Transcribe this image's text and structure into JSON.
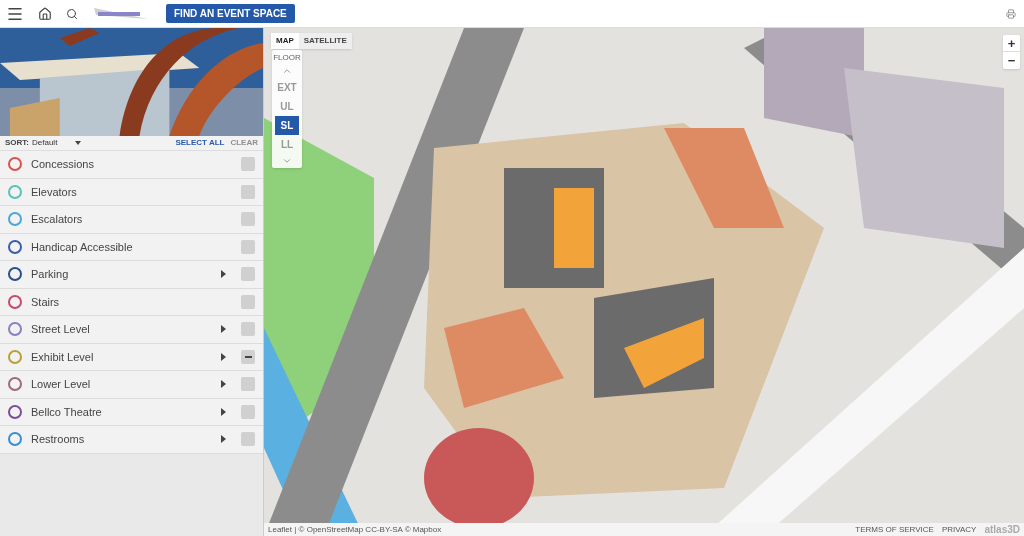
{
  "header": {
    "find_button": "FIND AN EVENT SPACE"
  },
  "sort": {
    "label": "SORT:",
    "value": "Default",
    "select_all": "SELECT ALL",
    "clear": {
      "label": "CLEAR",
      "disabled": true
    }
  },
  "categories": [
    {
      "name": "Concessions",
      "color": "#d9534f",
      "submenu": false,
      "partial": false
    },
    {
      "name": "Elevators",
      "color": "#5bc0be",
      "submenu": false,
      "partial": false
    },
    {
      "name": "Escalators",
      "color": "#4aa8d8",
      "submenu": false,
      "partial": false
    },
    {
      "name": "Handicap Accessible",
      "color": "#3b5ea8",
      "submenu": false,
      "partial": false
    },
    {
      "name": "Parking",
      "color": "#2b4d8c",
      "submenu": true,
      "partial": false
    },
    {
      "name": "Stairs",
      "color": "#c94a6a",
      "submenu": false,
      "partial": false
    },
    {
      "name": "Street Level",
      "color": "#8a7fc0",
      "submenu": true,
      "partial": false
    },
    {
      "name": "Exhibit Level",
      "color": "#b8a03a",
      "submenu": true,
      "partial": true
    },
    {
      "name": "Lower Level",
      "color": "#a06a7a",
      "submenu": true,
      "partial": false
    },
    {
      "name": "Bellco Theatre",
      "color": "#7b4f9e",
      "submenu": true,
      "partial": false
    },
    {
      "name": "Restrooms",
      "color": "#3a8fd0",
      "submenu": true,
      "partial": false
    }
  ],
  "map": {
    "map_types": [
      {
        "label": "MAP",
        "selected": true
      },
      {
        "label": "SATELLITE",
        "selected": false
      }
    ],
    "floor": {
      "title": "FLOOR",
      "levels": [
        {
          "label": "EXT",
          "selected": false
        },
        {
          "label": "UL",
          "selected": false
        },
        {
          "label": "SL",
          "selected": true
        },
        {
          "label": "LL",
          "selected": false
        }
      ]
    },
    "zoom": {
      "in": "+",
      "out": "−"
    },
    "attribution": "Leaflet | © OpenStreetMap CC-BY-SA © Mapbox",
    "links": [
      "TERMS OF SERVICE",
      "PRIVACY"
    ],
    "brand": "atlas3D"
  }
}
